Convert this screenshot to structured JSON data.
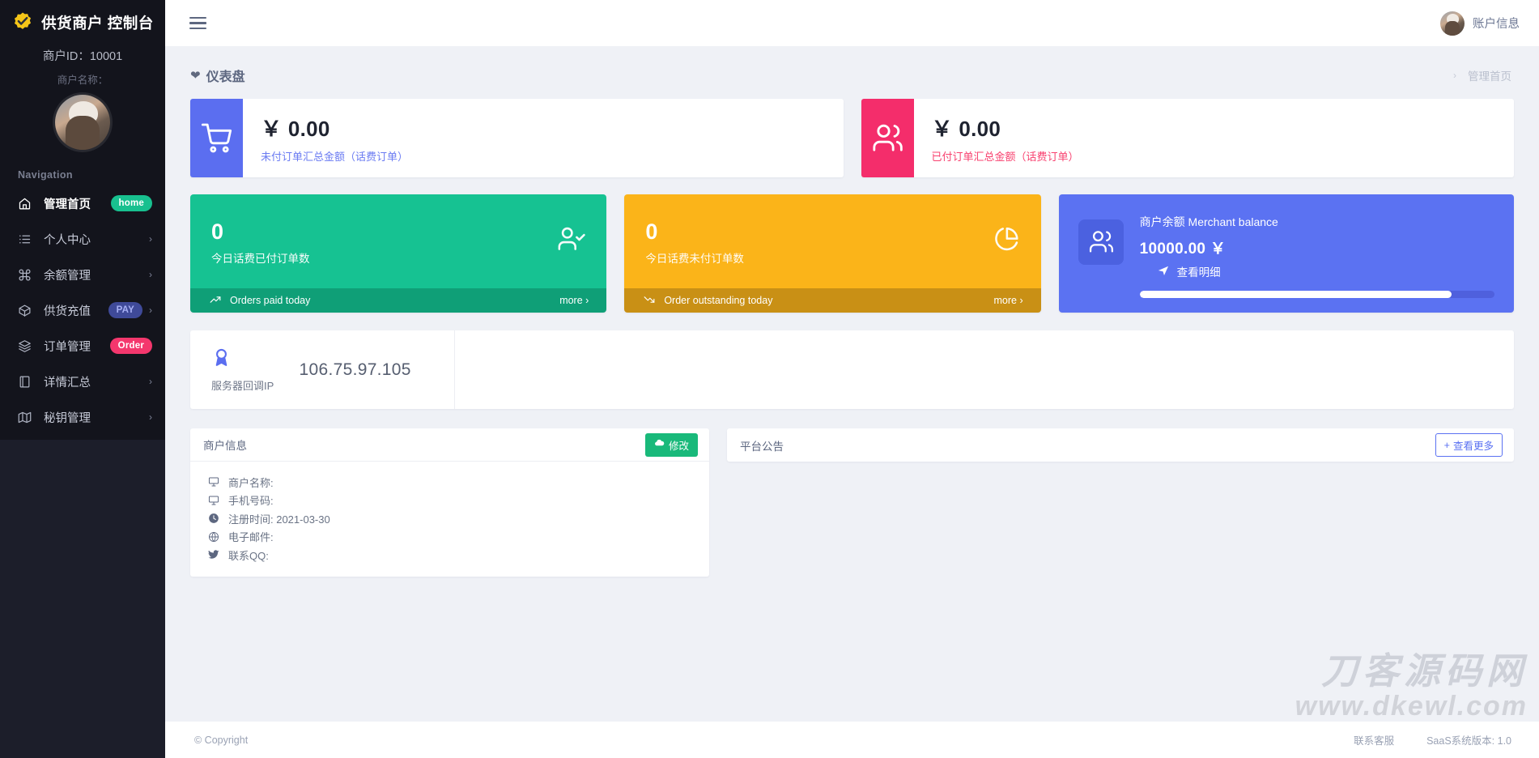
{
  "sidebar": {
    "brand": "供货商户 控制台",
    "logo_icon": "check-seal-icon",
    "merchant_id": "商户ID：10001",
    "merchant_name": "商户名称：",
    "avatar_icon": "user-avatar",
    "nav_label": "Navigation",
    "items": [
      {
        "label": "管理首页",
        "icon": "home-icon",
        "badge": "home",
        "badge_type": "home",
        "chevron": false,
        "active": true
      },
      {
        "label": "个人中心",
        "icon": "list-icon",
        "badge": "",
        "badge_type": "",
        "chevron": true,
        "active": false
      },
      {
        "label": "余额管理",
        "icon": "command-icon",
        "badge": "",
        "badge_type": "",
        "chevron": true,
        "active": false
      },
      {
        "label": "供货充值",
        "icon": "box-icon",
        "badge": "PAY",
        "badge_type": "pay",
        "chevron": true,
        "active": false
      },
      {
        "label": "订单管理",
        "icon": "layers-icon",
        "badge": "Order",
        "badge_type": "order",
        "chevron": false,
        "active": false
      },
      {
        "label": "详情汇总",
        "icon": "book-icon",
        "badge": "",
        "badge_type": "",
        "chevron": true,
        "active": false
      },
      {
        "label": "秘钥管理",
        "icon": "map-icon",
        "badge": "",
        "badge_type": "",
        "chevron": true,
        "active": false
      }
    ]
  },
  "topbar": {
    "menu_icon": "hamburger-icon",
    "account_label": "账户信息",
    "account_avatar": "user-avatar"
  },
  "page": {
    "title": "仪表盘",
    "title_icon": "heart-icon",
    "breadcrumb_sep": "›",
    "breadcrumb": "管理首页"
  },
  "money_cards": [
    {
      "amount": "￥ 0.00",
      "subtitle": "未付订单汇总金额（话费订单）",
      "icon": "shopping-cart-icon",
      "color": "#5b6ef0",
      "sub_color": "#6a7bf2"
    },
    {
      "amount": "￥ 0.00",
      "subtitle": "已付订单汇总金额（话费订单）",
      "icon": "users-icon",
      "color": "#f42d6b",
      "sub_color": "#f8416f"
    }
  ],
  "stat_cards": [
    {
      "number": "0",
      "label": "今日话费已付订单数",
      "foot_label": "Orders paid today",
      "more": "more",
      "more_chevron": "›",
      "icon": "user-check-icon",
      "foot_icon": "trend-up-icon",
      "color": "#16c292",
      "foot_color": "#0f9f77"
    },
    {
      "number": "0",
      "label": "今日话费未付订单数",
      "foot_label": "Order outstanding today",
      "more": "more",
      "more_chevron": "›",
      "icon": "pie-chart-icon",
      "foot_icon": "trend-down-icon",
      "color": "#fbb419",
      "foot_color": "#c99015"
    }
  ],
  "balance_card": {
    "title": "商户余额 Merchant balance",
    "amount": "10000.00 ￥",
    "link": "查看明细",
    "link_icon": "send-icon",
    "icon": "users-group-icon",
    "color": "#5b72f2",
    "icon_box_color": "#4b61e0",
    "progress_percent": 88
  },
  "ip_card": {
    "icon": "award-icon",
    "label": "服务器回调IP",
    "value": "106.75.97.105",
    "icon_color": "#5b6ef0"
  },
  "merchant_panel": {
    "title": "商户信息",
    "button_label": "修改",
    "button_icon": "cloud-icon",
    "rows": [
      {
        "icon": "monitor-icon",
        "text": "商户名称:"
      },
      {
        "icon": "monitor-icon",
        "text": "手机号码:"
      },
      {
        "icon": "clock-icon",
        "text": "注册时间: 2021-03-30"
      },
      {
        "icon": "globe-icon",
        "text": "电子邮件:"
      },
      {
        "icon": "twitter-icon",
        "text": "联系QQ:"
      }
    ]
  },
  "notice_panel": {
    "title": "平台公告",
    "button_label": "查看更多",
    "button_icon": "plus-icon"
  },
  "footer": {
    "copyright": "© Copyright",
    "support": "联系客服",
    "version": "SaaS系统版本: 1.0"
  },
  "watermark": {
    "line1": "刀客源码网",
    "line2": "www.dkewl.com"
  }
}
